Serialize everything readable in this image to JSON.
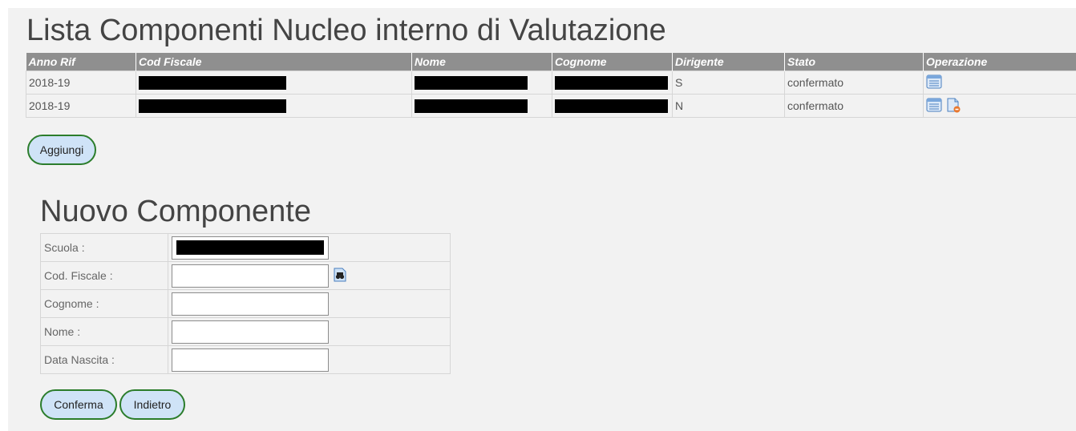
{
  "list": {
    "title": "Lista Componenti Nucleo interno di Valutazione",
    "columns": [
      "Anno Rif",
      "Cod Fiscale",
      "Nome",
      "Cognome",
      "Dirigente",
      "Stato",
      "Operazione"
    ],
    "rows": [
      {
        "anno": "2018-19",
        "dirigente": "S",
        "stato": "confermato"
      },
      {
        "anno": "2018-19",
        "dirigente": "N",
        "stato": "confermato"
      }
    ],
    "add_label": "Aggiungi"
  },
  "form": {
    "title": "Nuovo Componente",
    "fields": [
      {
        "label": "Scuola :"
      },
      {
        "label": "Cod. Fiscale :"
      },
      {
        "label": "Cognome :"
      },
      {
        "label": "Nome :"
      },
      {
        "label": "Data Nascita :"
      }
    ],
    "confirm_label": "Conferma",
    "back_label": "Indietro"
  },
  "icons": {
    "detail": "list-detail-icon",
    "delete": "document-delete-icon",
    "search": "binoculars-search-icon"
  },
  "colors": {
    "header_bg": "#8f8f8f",
    "button_bg": "#cfe3f7",
    "button_border": "#2c7d2c"
  }
}
